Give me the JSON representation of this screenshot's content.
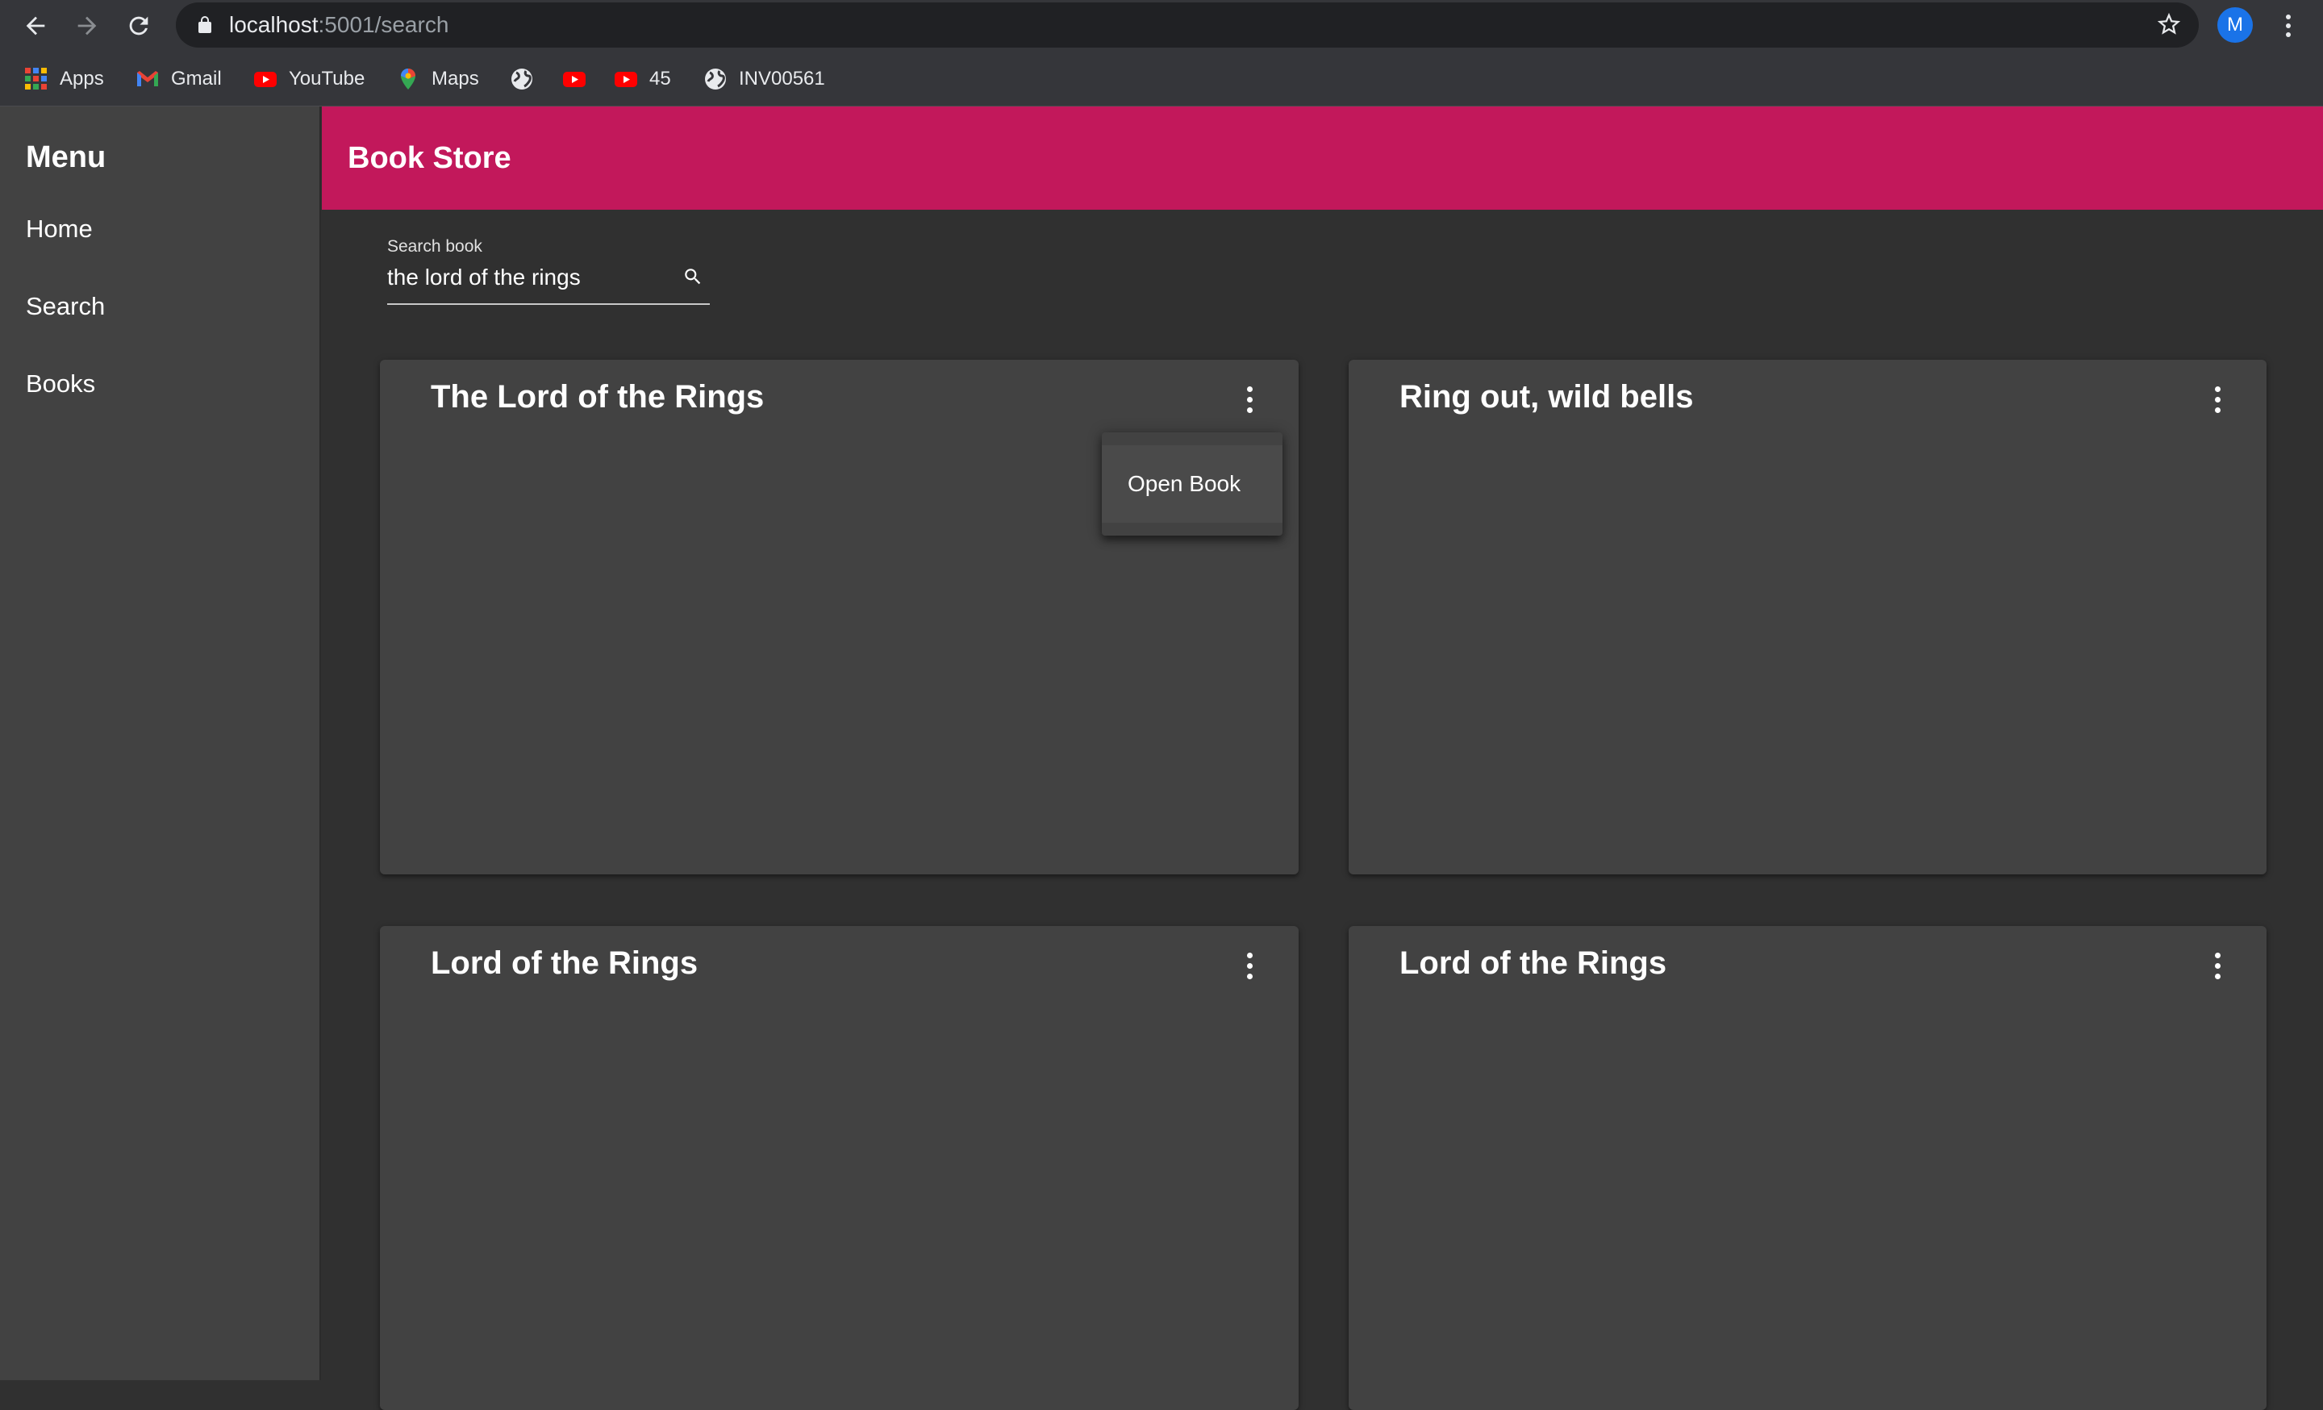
{
  "browser": {
    "url_host": "localhost",
    "url_path": ":5001/search",
    "avatar_letter": "M",
    "bookmarks": {
      "apps": "Apps",
      "gmail": "Gmail",
      "youtube": "YouTube",
      "maps": "Maps",
      "youtube_45": "45",
      "inv": "INV00561"
    }
  },
  "sidebar": {
    "title": "Menu",
    "items": [
      {
        "label": "Home"
      },
      {
        "label": "Search"
      },
      {
        "label": "Books"
      }
    ]
  },
  "appbar": {
    "title": "Book Store",
    "color": "#c2185b"
  },
  "search": {
    "label": "Search book",
    "value": "the lord of the rings"
  },
  "books": [
    {
      "title": "The Lord of the Rings"
    },
    {
      "title": "Ring out, wild bells"
    },
    {
      "title": "Lord of the Rings"
    },
    {
      "title": "Lord of the Rings"
    }
  ],
  "context_menu": {
    "open_book": "Open Book"
  }
}
